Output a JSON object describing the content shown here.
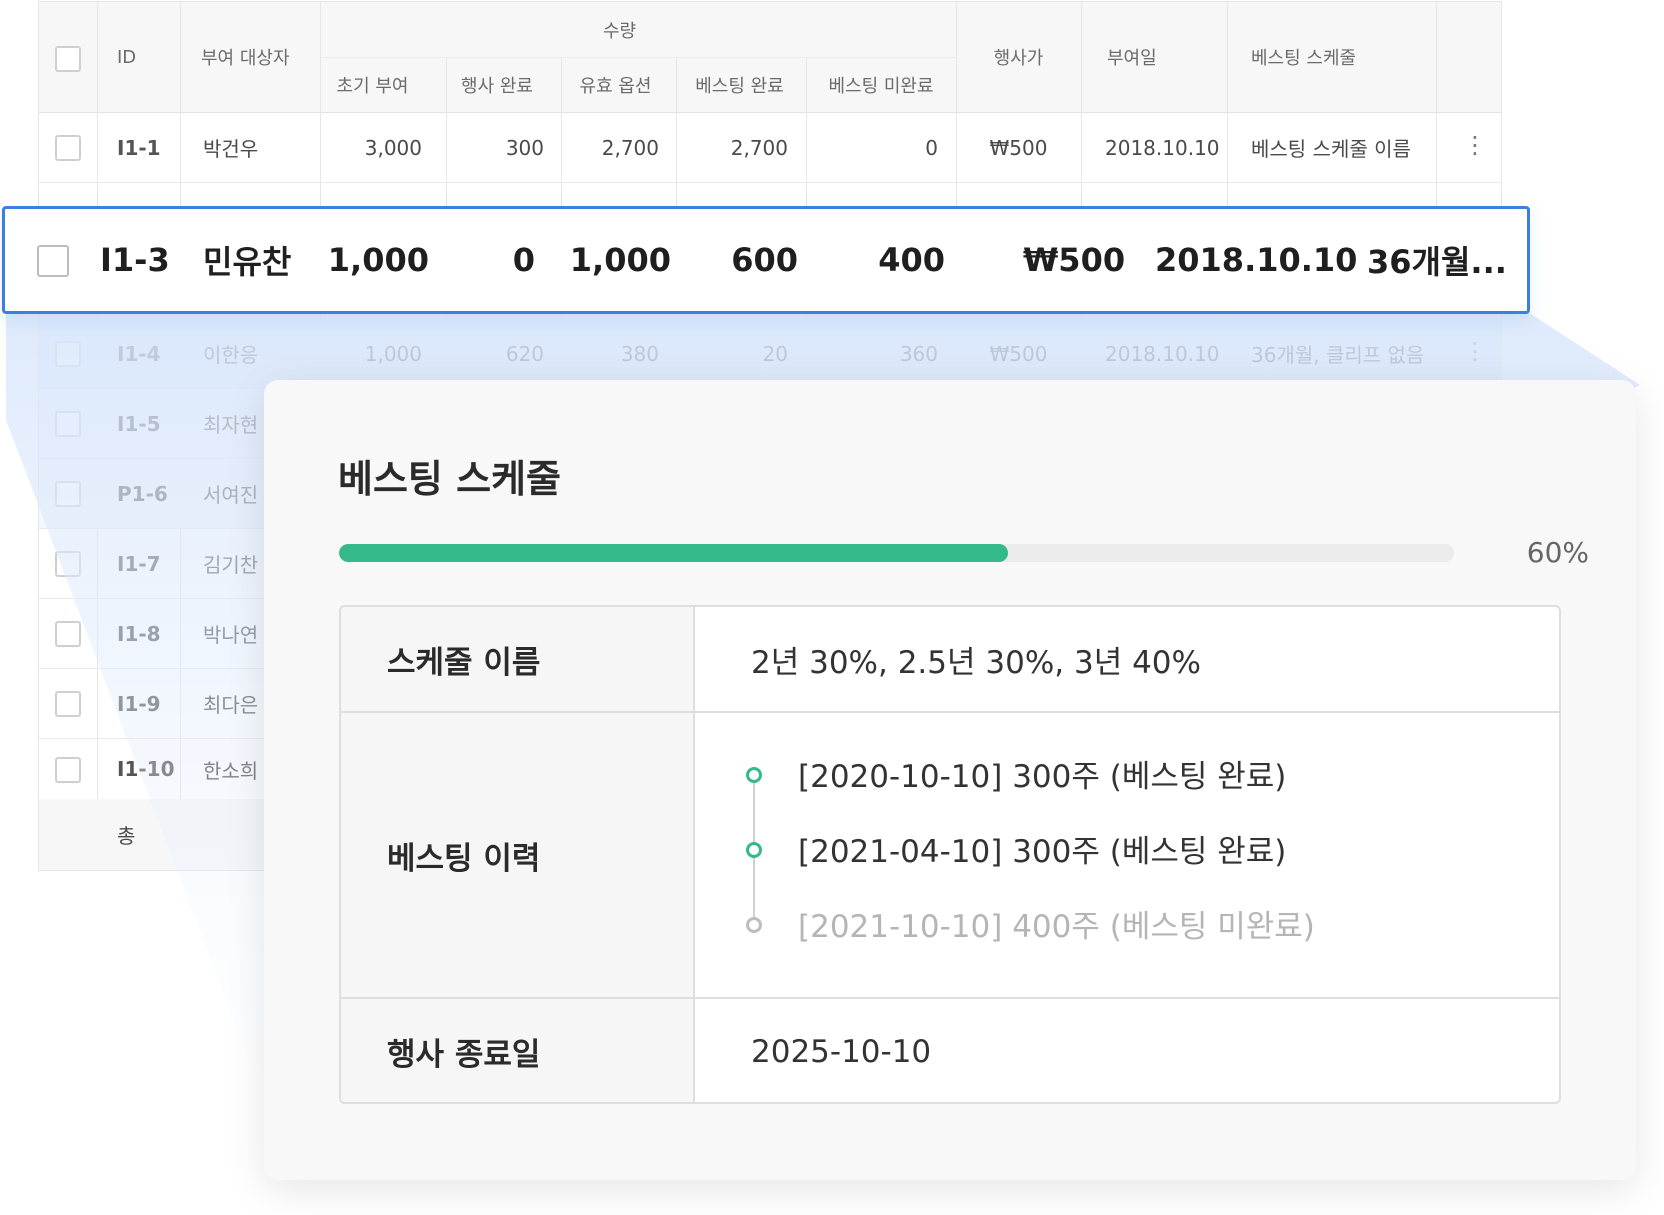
{
  "table": {
    "header": {
      "id": "ID",
      "recipient": "부여 대상자",
      "quantity_group": "수량",
      "initial_grant": "초기 부여",
      "exercised": "행사 완료",
      "valid_options": "유효 옵션",
      "vested": "베스팅 완료",
      "unvested": "베스팅 미완료",
      "strike_price": "행사가",
      "grant_date": "부여일",
      "vesting_schedule": "베스팅 스케줄"
    },
    "rows": [
      {
        "id": "I1-1",
        "name": "박건우",
        "initial": "3,000",
        "exercised": "300",
        "valid": "2,700",
        "vested": "2,700",
        "unvested": "0",
        "price": "₩500",
        "date": "2018.10.10",
        "schedule": "베스팅 스케줄 이름"
      },
      {
        "id": "I1-4",
        "name": "이한응",
        "initial": "1,000",
        "exercised": "620",
        "valid": "380",
        "vested": "20",
        "unvested": "360",
        "price": "₩500",
        "date": "2018.10.10",
        "schedule": "36개월, 클리프 없음"
      }
    ],
    "partial_rows": [
      {
        "id": "I1-5",
        "name": "최자현"
      },
      {
        "id": "P1-6",
        "name": "서여진"
      },
      {
        "id": "I1-7",
        "name": "김기찬"
      },
      {
        "id": "I1-8",
        "name": "박나연"
      },
      {
        "id": "I1-9",
        "name": "최다은"
      },
      {
        "id": "I1-10",
        "name": "한소희"
      }
    ],
    "total_label": "총"
  },
  "highlight_row": {
    "id": "I1-3",
    "name": "민유찬",
    "initial": "1,000",
    "exercised": "0",
    "valid": "1,000",
    "vested": "600",
    "unvested": "400",
    "price": "₩500",
    "date": "2018.10.10",
    "schedule": "36개월..."
  },
  "vesting_card": {
    "title": "베스팅 스케줄",
    "progress": 0.6,
    "progress_label": "60%",
    "schedule_name_label": "스케줄 이름",
    "schedule_name_value": "2년 30%, 2.5년 30%, 3년 40%",
    "history_label": "베스팅 이력",
    "history": [
      {
        "text": "[2020-10-10] 300주 (베스팅 완료)",
        "done": true
      },
      {
        "text": "[2021-04-10] 300주 (베스팅 완료)",
        "done": true
      },
      {
        "text": "[2021-10-10] 400주 (베스팅 미완료)",
        "done": false
      }
    ],
    "exercise_end_label": "행사 종료일",
    "exercise_end_value": "2025-10-10"
  },
  "colors": {
    "accent_blue": "#3b80e0",
    "progress_green": "#33b98a"
  }
}
